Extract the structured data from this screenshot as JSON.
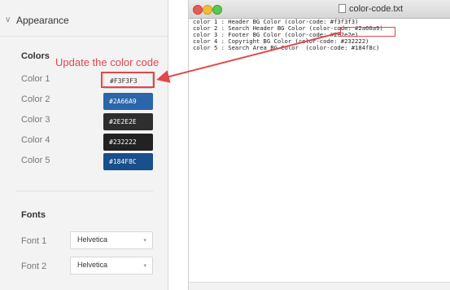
{
  "settings": {
    "appearance_label": "Appearance",
    "colors": {
      "title": "Colors",
      "items": [
        {
          "label": "Color 1",
          "code": "#F3F3F3",
          "hex": "#f3f3f3"
        },
        {
          "label": "Color 2",
          "code": "#2A66A9",
          "hex": "#2a66a9"
        },
        {
          "label": "Color 3",
          "code": "#2E2E2E",
          "hex": "#2e2e2e"
        },
        {
          "label": "Color 4",
          "code": "#232222",
          "hex": "#232222"
        },
        {
          "label": "Color 5",
          "code": "#184F8C",
          "hex": "#184f8c"
        }
      ]
    },
    "fonts": {
      "title": "Fonts",
      "items": [
        {
          "label": "Font 1",
          "value": "Helvetica"
        },
        {
          "label": "Font 2",
          "value": "Helvetica"
        }
      ]
    }
  },
  "annotation": {
    "text": "Update the color code",
    "color": "#e2474b"
  },
  "editor": {
    "filename": "color-code.txt",
    "lines": [
      "color 1 : Header BG Color (color-code: #f3f3f3)",
      "color 2 : Search Header BG Color (color-code: #2a66a9)",
      "color 3 : Footer BG Color (color-code: #2e2e2e)",
      "color 4 : Copyright BG Color (color-code: #232222)",
      "color 5 : Search Area BG Color  (color-code: #184f8c)"
    ]
  }
}
